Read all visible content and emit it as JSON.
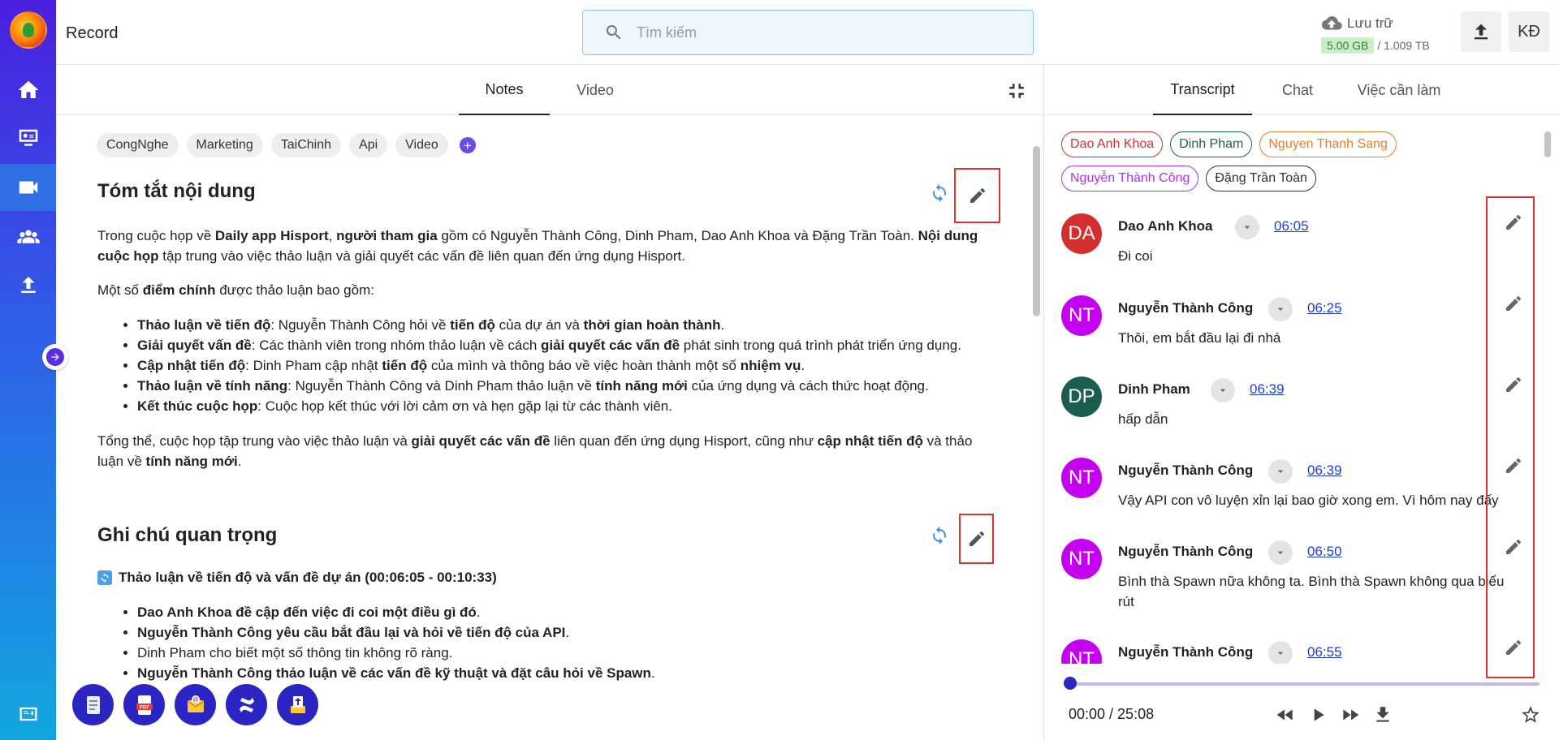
{
  "app": {
    "title": "Record"
  },
  "search": {
    "placeholder": "Tìm kiếm"
  },
  "storage": {
    "label": "Lưu trữ",
    "used": "5.00 GB",
    "total": "/ 1.009 TB"
  },
  "user": {
    "initials": "KĐ"
  },
  "left_tabs": [
    {
      "label": "Notes",
      "active": true
    },
    {
      "label": "Video",
      "active": false
    }
  ],
  "right_tabs": [
    {
      "label": "Transcript",
      "active": true
    },
    {
      "label": "Chat",
      "active": false
    },
    {
      "label": "Việc cần làm",
      "active": false
    }
  ],
  "tags": [
    "CongNghe",
    "Marketing",
    "TaiChinh",
    "Api",
    "Video"
  ],
  "summary": {
    "title": "Tóm tắt nội dung",
    "intro": {
      "t1": "Trong cuộc họp về ",
      "b1": "Daily app Hisport",
      "t2": ", ",
      "b2": "người tham gia",
      "t3": " gồm có Nguyễn Thành Công, Dinh Pham, Dao Anh Khoa và Đặng Trần Toàn. ",
      "b3": "Nội dung cuộc họp",
      "t4": " tập trung vào việc thảo luận và giải quyết các vấn đề liên quan đến ứng dụng Hisport."
    },
    "points_intro": {
      "t1": "Một số ",
      "b1": "điểm chính",
      "t2": " được thảo luận bao gồm:"
    },
    "points": [
      {
        "b": "Thảo luận về tiến độ",
        "t1": ": Nguyễn Thành Công hỏi về ",
        "b2": "tiến độ",
        "t2": " của dự án và ",
        "b3": "thời gian hoàn thành",
        "t3": "."
      },
      {
        "b": "Giải quyết vấn đề",
        "t1": ": Các thành viên trong nhóm thảo luận về cách ",
        "b2": "giải quyết các vấn đề",
        "t2": " phát sinh trong quá trình phát triển ứng dụng.",
        "b3": "",
        "t3": ""
      },
      {
        "b": "Cập nhật tiến độ",
        "t1": ": Dinh Pham cập nhật ",
        "b2": "tiến độ",
        "t2": " của mình và thông báo về việc hoàn thành một số ",
        "b3": "nhiệm vụ",
        "t3": "."
      },
      {
        "b": "Thảo luận về tính năng",
        "t1": ": Nguyễn Thành Công và Dinh Pham thảo luận về ",
        "b2": "tính năng mới",
        "t2": " của ứng dụng và cách thức hoạt động.",
        "b3": "",
        "t3": ""
      },
      {
        "b": "Kết thúc cuộc họp",
        "t1": ": Cuộc họp kết thúc với lời cảm ơn và hẹn gặp lại từ các thành viên.",
        "b2": "",
        "t2": "",
        "b3": "",
        "t3": ""
      }
    ],
    "conclusion": {
      "t1": "Tổng thể, cuộc họp tập trung vào việc thảo luận và ",
      "b1": "giải quyết các vấn đề",
      "t2": " liên quan đến ứng dụng Hisport, cũng như ",
      "b2": "cập nhật tiến độ",
      "t3": " và thảo luận về ",
      "b3": "tính năng mới",
      "t4": "."
    }
  },
  "important": {
    "title": "Ghi chú quan trọng",
    "subheading": "Thảo luận về tiến độ và vấn đề dự án (00:06:05 - 00:10:33)",
    "items": [
      {
        "bold": "Dao Anh Khoa đề cập đến việc đi coi một điều gì đó",
        "rest": "."
      },
      {
        "bold": "Nguyễn Thành Công yêu cầu bắt đầu lại và hỏi về tiến độ của API",
        "rest": "."
      },
      {
        "bold": "",
        "rest": "Dinh Pham cho biết một số thông tin không rõ ràng."
      },
      {
        "bold": "Nguyễn Thành Công thảo luận về các vấn đề kỹ thuật và đặt câu hỏi về Spawn",
        "rest": "."
      }
    ]
  },
  "speakers": [
    {
      "name": "Dao Anh Khoa",
      "color": "#d32f2f"
    },
    {
      "name": "Dinh Pham",
      "color": "#1b5e50"
    },
    {
      "name": "Nguyen Thanh Sang",
      "color": "#e67e22"
    },
    {
      "name": "Nguyễn Thành Công",
      "color": "#b030e8"
    },
    {
      "name": "Đặng Trần Toàn",
      "color": "#333333"
    }
  ],
  "transcript": [
    {
      "initials": "DA",
      "name": "Dao Anh Khoa",
      "time": "06:05",
      "text": "Đi coi",
      "color": "#d32f2f"
    },
    {
      "initials": "NT",
      "name": "Nguyễn Thành Công",
      "time": "06:25",
      "text": "Thôi, em bắt đầu lại đi nhá",
      "color": "#c400f0"
    },
    {
      "initials": "DP",
      "name": "Dinh Pham",
      "time": "06:39",
      "text": "hấp dẫn",
      "color": "#1b5e50"
    },
    {
      "initials": "NT",
      "name": "Nguyễn Thành Công",
      "time": "06:39",
      "text": "Vậy API con vô luyện xỉn lại bao giờ xong em. Vì hôm nay đấy",
      "color": "#c400f0"
    },
    {
      "initials": "NT",
      "name": "Nguyễn Thành Công",
      "time": "06:50",
      "text": "Bình thà Spawn nữa không ta. Bình thà Spawn không qua biểu rút",
      "color": "#c400f0"
    },
    {
      "initials": "NT",
      "name": "Nguyễn Thành Công",
      "time": "06:55",
      "text": "",
      "color": "#c400f0"
    }
  ],
  "player": {
    "time": "00:00 / 25:08",
    "progress": 0.0
  }
}
